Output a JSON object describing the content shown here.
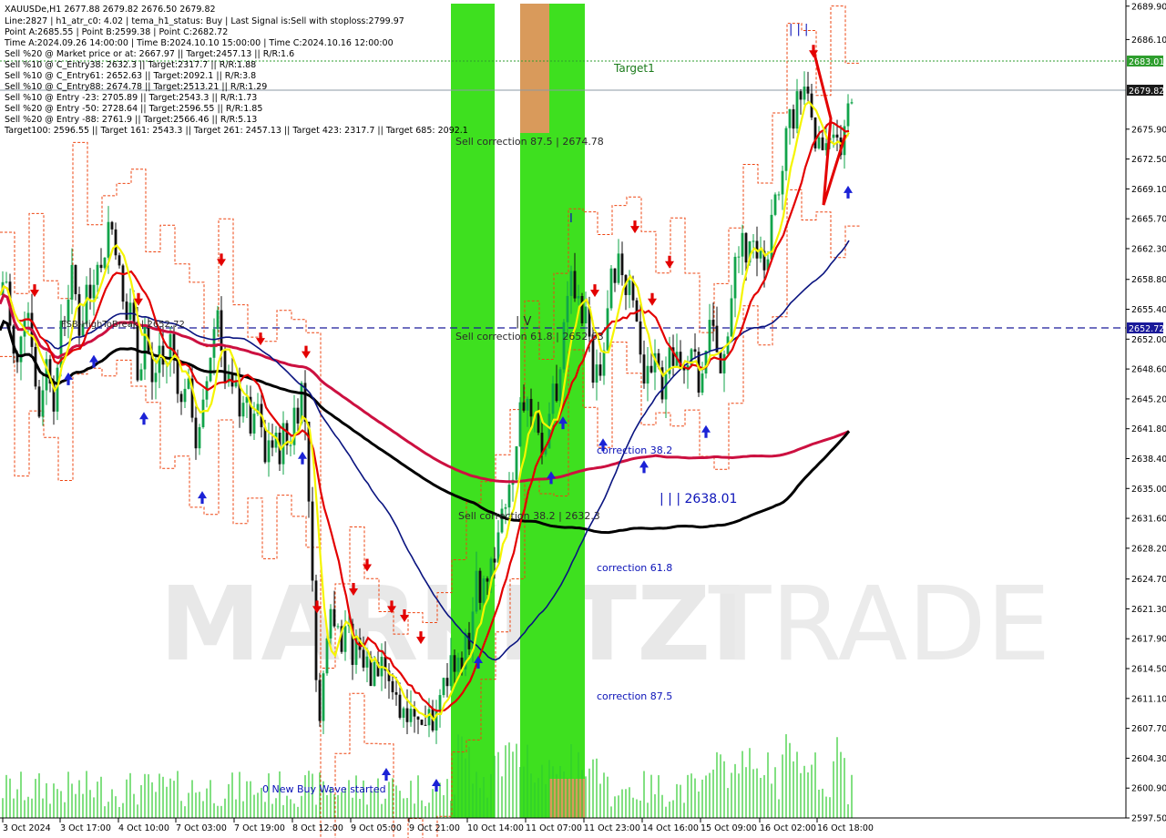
{
  "info": {
    "line1": "XAUUSDe,H1  2677.88 2679.82 2676.50 2679.82",
    "line2": "Line:2827 | h1_atr_c0: 4.02 | tema_h1_status: Buy | Last Signal is:Sell with stoploss:2799.97",
    "line3": "Point A:2685.55 | Point B:2599.38 | Point C:2682.72",
    "line4": "Time A:2024.09.26 14:00:00 | Time B:2024.10.10 15:00:00 | Time C:2024.10.16 12:00:00",
    "line5": "Sell %20 @ Market price or at: 2667.97 || Target:2457.13 || R/R:1.6",
    "line6": "Sell %10 @ C_Entry38: 2632.3 || Target:2317.7 || R/R:1.88",
    "line7": "Sell %10 @ C_Entry61: 2652.63 || Target:2092.1 || R/R:3.8",
    "line8": "Sell %10 @ C_Entry88: 2674.78 || Target:2513.21 || R/R:1.29",
    "line9": "Sell %10 @ Entry -23: 2705.89 || Target:2543.3 || R/R:1.73",
    "line10": "Sell %20 @ Entry -50: 2728.64 || Target:2596.55 || R/R:1.85",
    "line11": "Sell %20 @ Entry -88: 2761.9 || Target:2566.46 || R/R:5.13",
    "line12": "Target100: 2596.55 || Target 161: 2543.3 || Target 261: 2457.13 || Target 423: 2317.7 || Target 685: 2092.1"
  },
  "labels": {
    "target1": "Target1",
    "sell_corr_875": "Sell correction 87.5 | 2674.78",
    "sell_corr_618": "Sell correction 61.8 | 2652.63",
    "sell_corr_382": "Sell correction 38.2 | 2632.3",
    "corr_382": "correction 38.2",
    "corr_618": "correction 61.8",
    "corr_875": "correction 87.5",
    "wave_level": "| | | 2638.01",
    "new_buy_wave": "0 New Buy Wave started",
    "fsb": "FSB-HighToBreak | 2652.72",
    "top_marker": "| | |",
    "mid_marker": "| V",
    "i_marker": "I",
    "watermark_a": "MARKETZI",
    "watermark_b": "TRADE"
  },
  "price_tags": {
    "green_level": "2683.01",
    "current": "2679.82",
    "blue_level": "2652.72"
  },
  "colors": {
    "green_zone": "#3ee01f",
    "orange_zone": "#d99a5b",
    "bull_candle": "#11a44a",
    "bear_candle": "#111111",
    "volume": "#2fcc2f",
    "ma_red": "#e30000",
    "ma_yellow": "#f5f500",
    "ma_navy": "#0a1480",
    "ma_black": "#000000",
    "ma_crimson": "#cc1040",
    "dashed_orange": "#ee4411",
    "fsb_line": "#1a1a9a",
    "target_line": "#2e9e2e"
  },
  "chart_data": {
    "type": "line",
    "symbol": "XAUUSDe",
    "timeframe": "H1",
    "x_ticks": [
      "3 Oct 2024",
      "3 Oct 17:00",
      "4 Oct 10:00",
      "7 Oct 03:00",
      "7 Oct 19:00",
      "8 Oct 12:00",
      "9 Oct 05:00",
      "9 Oct 21:00",
      "10 Oct 14:00",
      "11 Oct 07:00",
      "11 Oct 23:00",
      "14 Oct 16:00",
      "15 Oct 09:00",
      "16 Oct 02:00",
      "16 Oct 18:00"
    ],
    "y_ticks": [
      "2689.90",
      "2686.10",
      "2683.01",
      "2679.82",
      "2675.90",
      "2672.50",
      "2669.10",
      "2665.70",
      "2662.30",
      "2658.80",
      "2655.40",
      "2652.72",
      "2652.00",
      "2648.60",
      "2645.20",
      "2641.80",
      "2638.40",
      "2635.00",
      "2631.60",
      "2628.20",
      "2624.70",
      "2621.30",
      "2617.90",
      "2614.50",
      "2611.10",
      "2607.70",
      "2604.30",
      "2600.90",
      "2597.50"
    ],
    "ylim": [
      2597.5,
      2690.6
    ],
    "levels": {
      "target1": 2683.01,
      "current": 2679.82,
      "fsb_high_to_break": 2652.72
    },
    "close_path": [
      [
        0,
        2657
      ],
      [
        6,
        2660
      ],
      [
        12,
        2652
      ],
      [
        18,
        2648
      ],
      [
        24,
        2654
      ],
      [
        30,
        2656
      ],
      [
        36,
        2651
      ],
      [
        40,
        2645
      ],
      [
        44,
        2643
      ],
      [
        48,
        2648
      ],
      [
        52,
        2650
      ],
      [
        56,
        2647
      ],
      [
        60,
        2644
      ],
      [
        64,
        2649
      ],
      [
        68,
        2656
      ],
      [
        72,
        2654
      ],
      [
        76,
        2658
      ],
      [
        80,
        2660
      ],
      [
        84,
        2656
      ],
      [
        88,
        2652
      ],
      [
        92,
        2655
      ],
      [
        96,
        2659
      ],
      [
        100,
        2656
      ],
      [
        104,
        2660
      ],
      [
        108,
        2662
      ],
      [
        112,
        2659
      ],
      [
        116,
        2663
      ],
      [
        120,
        2666
      ],
      [
        124,
        2664
      ],
      [
        128,
        2662
      ],
      [
        132,
        2659
      ],
      [
        136,
        2655
      ],
      [
        140,
        2654
      ],
      [
        144,
        2657
      ],
      [
        148,
        2652
      ],
      [
        152,
        2647
      ],
      [
        156,
        2650
      ],
      [
        160,
        2655
      ],
      [
        164,
        2649
      ],
      [
        168,
        2646
      ],
      [
        172,
        2649
      ],
      [
        176,
        2652
      ],
      [
        180,
        2648
      ],
      [
        184,
        2650
      ],
      [
        188,
        2653
      ],
      [
        192,
        2649
      ],
      [
        196,
        2646
      ],
      [
        200,
        2644
      ],
      [
        204,
        2648
      ],
      [
        208,
        2646
      ],
      [
        212,
        2643
      ],
      [
        216,
        2639
      ],
      [
        220,
        2642
      ],
      [
        224,
        2645
      ],
      [
        228,
        2648
      ],
      [
        232,
        2651
      ],
      [
        236,
        2654
      ],
      [
        240,
        2656
      ],
      [
        244,
        2650
      ],
      [
        248,
        2646
      ],
      [
        252,
        2648
      ],
      [
        256,
        2645
      ],
      [
        260,
        2647
      ],
      [
        264,
        2643
      ],
      [
        268,
        2646
      ],
      [
        272,
        2644
      ],
      [
        276,
        2641
      ],
      [
        280,
        2643
      ],
      [
        284,
        2645
      ],
      [
        288,
        2640
      ],
      [
        292,
        2637
      ],
      [
        296,
        2642
      ],
      [
        300,
        2639
      ],
      [
        304,
        2641
      ],
      [
        308,
        2638
      ],
      [
        312,
        2643
      ],
      [
        316,
        2639
      ],
      [
        320,
        2641
      ],
      [
        324,
        2645
      ],
      [
        328,
        2643
      ],
      [
        332,
        2648
      ],
      [
        336,
        2641
      ],
      [
        340,
        2632
      ],
      [
        344,
        2621
      ],
      [
        348,
        2612
      ],
      [
        352,
        2607
      ],
      [
        356,
        2616
      ],
      [
        360,
        2620
      ],
      [
        364,
        2623
      ],
      [
        368,
        2618
      ],
      [
        372,
        2621
      ],
      [
        376,
        2616
      ],
      [
        380,
        2621
      ],
      [
        384,
        2618
      ],
      [
        388,
        2614
      ],
      [
        392,
        2619
      ],
      [
        396,
        2617
      ],
      [
        400,
        2613
      ],
      [
        404,
        2618
      ],
      [
        408,
        2611
      ],
      [
        412,
        2616
      ],
      [
        416,
        2613
      ],
      [
        420,
        2617
      ],
      [
        424,
        2612
      ],
      [
        428,
        2614
      ],
      [
        432,
        2610
      ],
      [
        436,
        2613
      ],
      [
        440,
        2608
      ],
      [
        444,
        2611
      ],
      [
        448,
        2609
      ],
      [
        452,
        2611
      ],
      [
        456,
        2608
      ],
      [
        460,
        2610
      ],
      [
        464,
        2607
      ],
      [
        468,
        2609
      ],
      [
        472,
        2611
      ],
      [
        476,
        2607
      ],
      [
        480,
        2612
      ],
      [
        484,
        2610
      ],
      [
        488,
        2614
      ],
      [
        492,
        2612
      ],
      [
        496,
        2616
      ],
      [
        500,
        2613
      ],
      [
        504,
        2617
      ],
      [
        508,
        2615
      ],
      [
        512,
        2619
      ],
      [
        516,
        2615
      ],
      [
        520,
        2622
      ],
      [
        524,
        2626
      ],
      [
        528,
        2621
      ],
      [
        532,
        2627
      ],
      [
        536,
        2624
      ],
      [
        540,
        2629
      ],
      [
        544,
        2627
      ],
      [
        548,
        2631
      ],
      [
        552,
        2634
      ],
      [
        556,
        2632
      ],
      [
        560,
        2637
      ],
      [
        564,
        2635
      ],
      [
        568,
        2640
      ],
      [
        572,
        2645
      ],
      [
        576,
        2643
      ],
      [
        580,
        2647
      ],
      [
        584,
        2642
      ],
      [
        588,
        2645
      ],
      [
        592,
        2641
      ],
      [
        596,
        2637
      ],
      [
        600,
        2641
      ],
      [
        604,
        2645
      ],
      [
        608,
        2648
      ],
      [
        612,
        2645
      ],
      [
        616,
        2650
      ],
      [
        620,
        2654
      ],
      [
        624,
        2657
      ],
      [
        628,
        2660
      ],
      [
        632,
        2655
      ],
      [
        636,
        2658
      ],
      [
        640,
        2653
      ],
      [
        644,
        2656
      ],
      [
        648,
        2650
      ],
      [
        652,
        2647
      ],
      [
        656,
        2651
      ],
      [
        660,
        2647
      ],
      [
        664,
        2652
      ],
      [
        668,
        2656
      ],
      [
        672,
        2660
      ],
      [
        676,
        2657
      ],
      [
        680,
        2662
      ],
      [
        684,
        2659
      ],
      [
        688,
        2657
      ],
      [
        692,
        2660
      ],
      [
        696,
        2656
      ],
      [
        700,
        2653
      ],
      [
        704,
        2650
      ],
      [
        708,
        2646
      ],
      [
        712,
        2650
      ],
      [
        716,
        2647
      ],
      [
        720,
        2651
      ],
      [
        724,
        2648
      ],
      [
        728,
        2645
      ],
      [
        732,
        2649
      ],
      [
        736,
        2652
      ],
      [
        740,
        2648
      ],
      [
        744,
        2651
      ],
      [
        748,
        2647
      ],
      [
        752,
        2650
      ],
      [
        756,
        2648
      ],
      [
        760,
        2652
      ],
      [
        764,
        2649
      ],
      [
        768,
        2645
      ],
      [
        772,
        2648
      ],
      [
        776,
        2652
      ],
      [
        780,
        2655
      ],
      [
        784,
        2652
      ],
      [
        788,
        2650
      ],
      [
        792,
        2647
      ],
      [
        796,
        2651
      ],
      [
        800,
        2654
      ],
      [
        804,
        2658
      ],
      [
        808,
        2662
      ],
      [
        812,
        2660
      ],
      [
        816,
        2664
      ],
      [
        820,
        2661
      ],
      [
        824,
        2665
      ],
      [
        828,
        2662
      ],
      [
        832,
        2660
      ],
      [
        836,
        2662
      ],
      [
        840,
        2659
      ],
      [
        844,
        2663
      ],
      [
        848,
        2666
      ],
      [
        852,
        2669
      ],
      [
        856,
        2667
      ],
      [
        860,
        2672
      ],
      [
        864,
        2676
      ],
      [
        868,
        2679
      ],
      [
        872,
        2676
      ],
      [
        876,
        2681
      ],
      [
        880,
        2678
      ],
      [
        884,
        2682
      ],
      [
        888,
        2678
      ],
      [
        892,
        2676
      ],
      [
        896,
        2673
      ],
      [
        900,
        2675
      ],
      [
        904,
        2672
      ],
      [
        908,
        2675
      ],
      [
        912,
        2676
      ],
      [
        916,
        2674
      ],
      [
        920,
        2675
      ],
      [
        924,
        2673
      ],
      [
        928,
        2676
      ],
      [
        932,
        2679
      ],
      [
        935,
        2679.82
      ]
    ]
  }
}
